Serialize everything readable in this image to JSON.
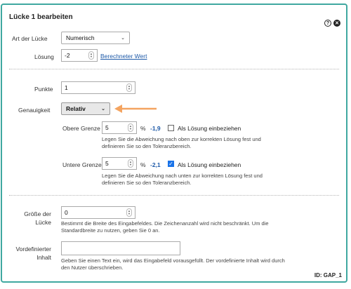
{
  "title": "Lücke 1 bearbeiten",
  "icons": {
    "help": "help-icon",
    "close": "close-icon"
  },
  "gap_type": {
    "label": "Art der Lücke",
    "value": "Numerisch"
  },
  "solution": {
    "label": "Lösung",
    "value": "-2",
    "link": "Berechneter Wert"
  },
  "points": {
    "label": "Punkte",
    "value": "1"
  },
  "precision": {
    "label": "Genauigkeit",
    "value": "Relativ"
  },
  "upper": {
    "label": "Obere Grenze",
    "value": "5",
    "unit": "%",
    "deviation": "-1,9",
    "checkbox_label": "Als Lösung einbeziehen",
    "checked": false,
    "help_line1": "Legen Sie die Abweichung nach oben zur korrekten Lösung fest und",
    "help_line2": "definieren Sie so den Toleranzbereich."
  },
  "lower": {
    "label": "Untere Grenze",
    "value": "5",
    "unit": "%",
    "deviation": "-2,1",
    "checkbox_label": "Als Lösung einbeziehen",
    "checked": true,
    "help_line1": "Legen Sie die Abweichung nach unten zur korrekten Lösung fest und",
    "help_line2": "definieren Sie so den Toleranzbereich."
  },
  "gap_size": {
    "label_line1": "Größe der",
    "label_line2": "Lücke",
    "value": "0",
    "help_line1": "Bestimmt die Breite des Eingabefeldes. Die Zeichenanzahl wird nicht beschränkt. Um die",
    "help_line2": "Standardbreite zu nutzen, geben Sie 0 an."
  },
  "predefined": {
    "label_line1": "Vordefinierter",
    "label_line2": "Inhalt",
    "value": "",
    "help_line1": "Geben Sie einen Text ein, wird das Eingabefeld vorausgefüllt. Der vordefinierte Inhalt wird durch",
    "help_line2": "den Nutzer überschrieben."
  },
  "gap_id": "ID: GAP_1",
  "colors": {
    "border": "#3fa8a0",
    "arrow": "#f4a460",
    "link": "#1e5aa8",
    "checkbox": "#1a73e8"
  }
}
